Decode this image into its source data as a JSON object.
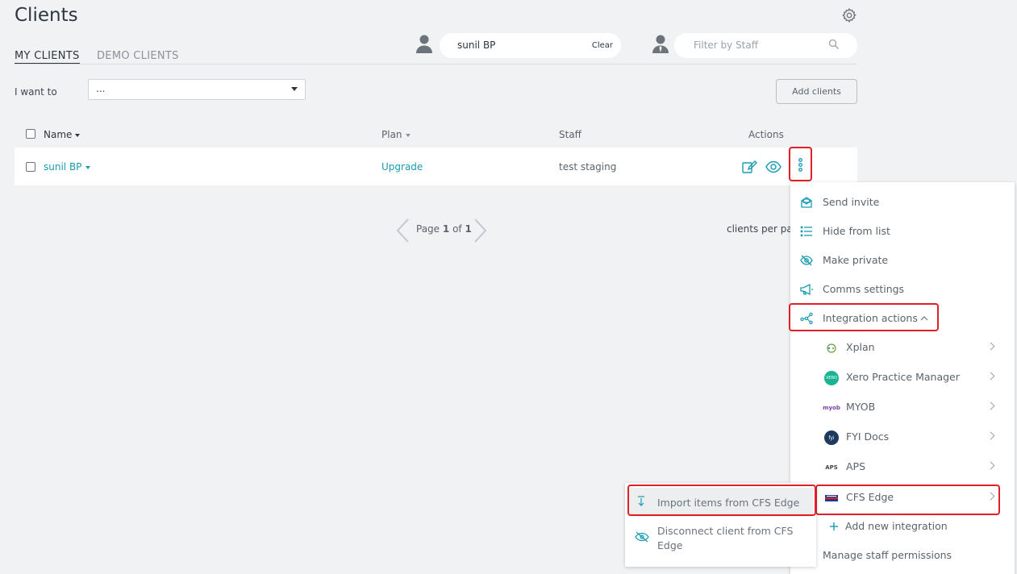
{
  "header": {
    "title": "Clients"
  },
  "tabs": {
    "my_clients": "MY CLIENTS",
    "demo_clients": "DEMO CLIENTS"
  },
  "client_search": {
    "value": "sunil BP",
    "clear_label": "Clear"
  },
  "staff_filter": {
    "placeholder": "Filter by Staff"
  },
  "bulk": {
    "label": "I want to",
    "select_value": "..."
  },
  "add_clients_label": "Add clients",
  "table": {
    "headers": {
      "name": "Name",
      "plan": "Plan",
      "staff": "Staff",
      "actions": "Actions"
    },
    "rows": [
      {
        "name": "sunil BP",
        "plan": "Upgrade",
        "staff": "test staging"
      }
    ]
  },
  "pagination": {
    "page_label": "Page",
    "current": "1",
    "of_label": "of",
    "total": "1",
    "per_page_label": "clients per pa"
  },
  "actions_menu": {
    "items": [
      {
        "label": "Send invite",
        "icon": "send-invite-icon"
      },
      {
        "label": "Hide from list",
        "icon": "list-icon"
      },
      {
        "label": "Make private",
        "icon": "eye-slash-icon"
      },
      {
        "label": "Comms settings",
        "icon": "megaphone-icon"
      },
      {
        "label": "Integration actions",
        "icon": "integration-icon"
      }
    ],
    "integrations": [
      {
        "label": "Xplan",
        "icon": "xplan-logo-icon"
      },
      {
        "label": "Xero Practice Manager",
        "icon": "xero-logo-icon",
        "logo_text": "XERO"
      },
      {
        "label": "MYOB",
        "icon": "myob-logo-icon",
        "logo_text": "myob"
      },
      {
        "label": "FYI Docs",
        "icon": "fyi-logo-icon",
        "logo_text": "fyi"
      },
      {
        "label": "APS",
        "icon": "aps-logo-icon",
        "logo_text": "APS"
      },
      {
        "label": "CFS Edge",
        "icon": "cfs-logo-icon"
      }
    ],
    "add_integration": "Add new integration",
    "manage_permissions": "Manage staff permissions"
  },
  "cfs_flyout": {
    "import_label": "Import items from CFS Edge",
    "disconnect_line1": "Disconnect client from CFS",
    "disconnect_line2": "Edge"
  },
  "colors": {
    "accent": "#1a9bb3",
    "highlight_border": "#e01f26",
    "background": "#f1f2f4"
  }
}
